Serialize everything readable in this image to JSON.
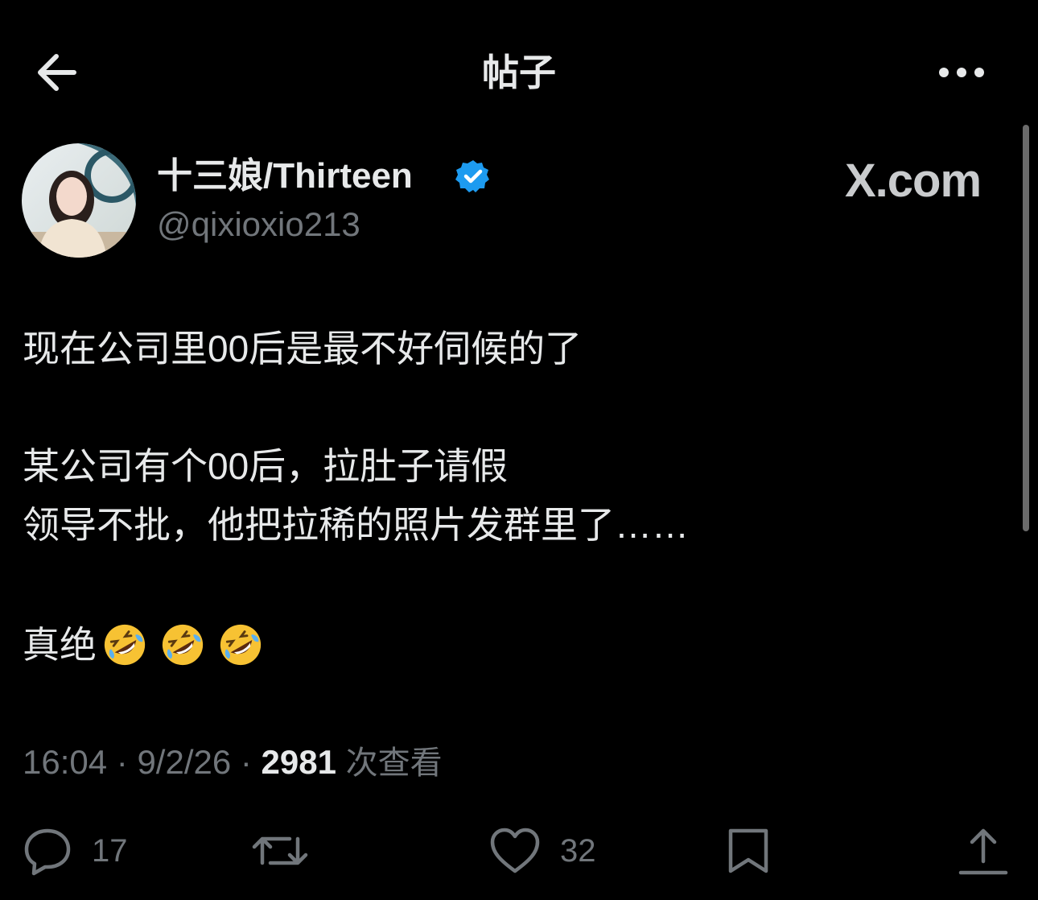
{
  "header": {
    "title": "帖子",
    "back_icon": "arrow-left-icon",
    "more_icon": "more-horizontal-icon"
  },
  "author": {
    "name": "十三娘/Thirteen",
    "handle": "@qixioxio213",
    "verified_color": "#1d9bf0"
  },
  "watermark": "X.com",
  "post": {
    "lines": [
      "现在公司里00后是最不好伺候的了",
      "某公司有个00后，拉肚子请假",
      "领导不批，他把拉稀的照片发群里了……",
      "真绝"
    ],
    "emojis": [
      "rolling-on-floor-laughing",
      "rolling-on-floor-laughing",
      "rolling-on-floor-laughing"
    ]
  },
  "meta": {
    "time": "16:04",
    "date": "9/2/26",
    "separator": " · ",
    "views_count": "2981",
    "views_label": "次查看"
  },
  "actions": {
    "reply_count": "17",
    "like_count": "32"
  },
  "colors": {
    "background": "#000000",
    "text": "#e7e9ea",
    "muted": "#71767b",
    "accent": "#1d9bf0"
  }
}
